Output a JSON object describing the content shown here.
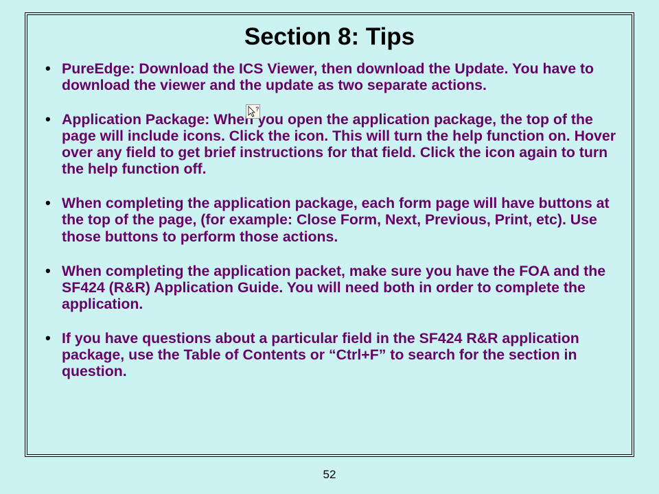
{
  "title": "Section 8: Tips",
  "bullets": [
    "PureEdge:  Download the ICS Viewer, then download the Update. You have to download the viewer and the update as two separate actions.",
    "Application Package:  When you open the application package, the top of the page will include icons.  Click the      icon.  This will turn the help function on.  Hover over any field to get brief instructions for that field.  Click the icon again to turn the help function off.",
    "When completing the application package, each form page will have buttons at the top of the page, (for example: Close Form, Next, Previous, Print, etc).  Use those buttons to perform those actions.",
    "When completing the application packet, make sure you have the FOA and the SF424 (R&R) Application Guide.  You will need both in order to complete the application.",
    "If you have questions about a particular field in the SF424 R&R application package, use the Table of Contents or “Ctrl+F” to search for the section in question."
  ],
  "pageNumber": "52"
}
